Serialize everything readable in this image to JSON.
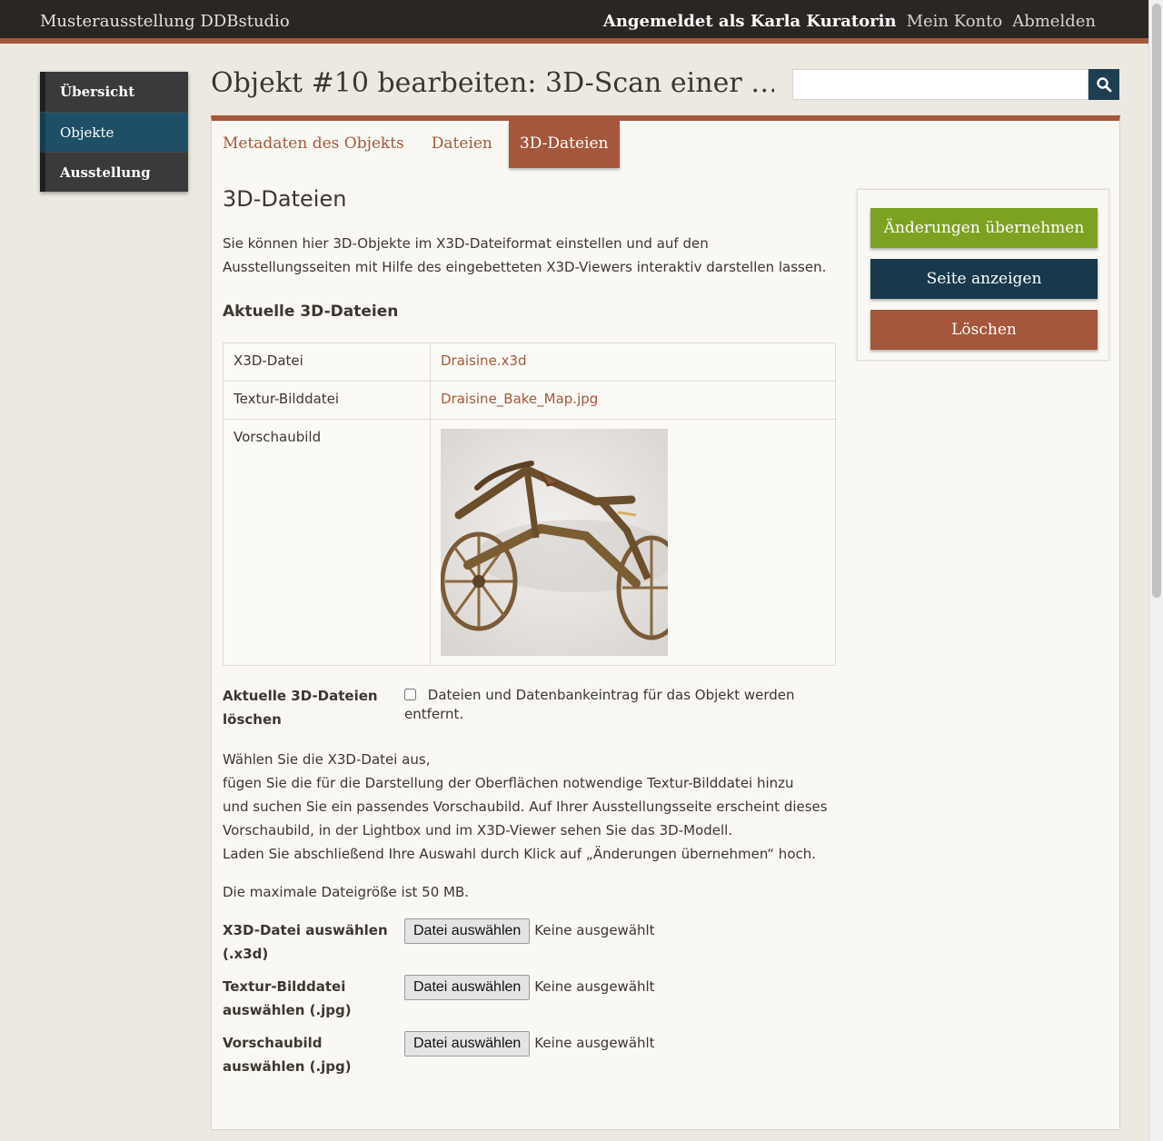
{
  "header": {
    "site_title": "Musterausstellung DDBstudio",
    "logged_in_as": "Angemeldet als Karla Kuratorin",
    "my_account": "Mein Konto",
    "logout": "Abmelden"
  },
  "sidebar": {
    "items": [
      {
        "label": "Übersicht"
      },
      {
        "label": "Objekte"
      },
      {
        "label": "Ausstellung"
      }
    ],
    "active": "Objekte"
  },
  "page": {
    "title": "Objekt #10 bearbeiten: 3D-Scan einer …"
  },
  "search": {
    "value": "",
    "icon": "search-icon"
  },
  "tabs": [
    {
      "label": "Metadaten des Objekts"
    },
    {
      "label": "Dateien"
    },
    {
      "label": "3D-Dateien"
    }
  ],
  "active_tab": "3D-Dateien",
  "content": {
    "section_title": "3D-Dateien",
    "intro": "Sie können hier 3D-Objekte im X3D-Dateiformat einstellen und auf den Ausstellungsseiten mit Hilfe des eingebetteten X3D-Viewers interaktiv darstellen lassen.",
    "current_heading": "Aktuelle 3D-Dateien",
    "files": {
      "x3d_label": "X3D-Datei",
      "x3d_value": "Draisine.x3d",
      "texture_label": "Textur-Bilddatei",
      "texture_value": "Draisine_Bake_Map.jpg",
      "preview_label": "Vorschaubild"
    },
    "delete": {
      "label_line1": "Aktuelle 3D-Dateien",
      "label_line2": "löschen",
      "option": "Dateien und Datenbankeintrag für das Objekt werden entfernt.",
      "checked": false
    },
    "help_lines": [
      "Wählen Sie die X3D-Datei aus,",
      "fügen Sie die für die Darstellung der Oberflächen notwendige Textur-Bilddatei hinzu",
      "und suchen Sie ein passendes Vorschaubild. Auf Ihrer Ausstellungsseite erscheint dieses",
      "Vorschaubild, in der Lightbox und im X3D-Viewer sehen Sie das 3D-Modell.",
      "Laden Sie abschließend Ihre Auswahl durch Klick auf „Änderungen übernehmen“ hoch."
    ],
    "max_size": "Die maximale Dateigröße ist 50 MB.",
    "uploads": [
      {
        "label_line1": "X3D-Datei auswählen",
        "label_line2": "(.x3d)",
        "button": "Datei auswählen",
        "status": "Keine ausgewählt"
      },
      {
        "label_line1": "Textur-Bilddatei",
        "label_line2": "auswählen (.jpg)",
        "button": "Datei auswählen",
        "status": "Keine ausgewählt"
      },
      {
        "label_line1": "Vorschaubild",
        "label_line2": "auswählen (.jpg)",
        "button": "Datei auswählen",
        "status": "Keine ausgewählt"
      }
    ]
  },
  "actions": {
    "apply": "Änderungen übernehmen",
    "view": "Seite anzeigen",
    "delete": "Löschen"
  },
  "colors": {
    "accent": "#a4573b",
    "topbar": "#2b2624",
    "apply_green": "#7da221",
    "view_navy": "#17394b",
    "sidebar_active": "#1e4f66"
  }
}
